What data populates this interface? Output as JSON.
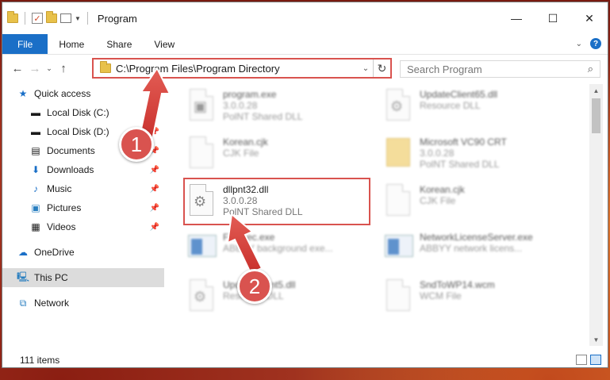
{
  "window": {
    "title": "Program"
  },
  "ribbon": {
    "tabs": [
      "File",
      "Home",
      "Share",
      "View"
    ]
  },
  "nav": {
    "address": "C:\\Program Files\\Program Directory",
    "search_placeholder": "Search Program"
  },
  "sidebar": {
    "quick_access": "Quick access",
    "items": [
      {
        "label": "Local Disk (C:)",
        "icon": "drive-icon"
      },
      {
        "label": "Local Disk (D:)",
        "icon": "drive-icon"
      },
      {
        "label": "Documents",
        "icon": "documents-icon"
      },
      {
        "label": "Downloads",
        "icon": "downloads-icon"
      },
      {
        "label": "Music",
        "icon": "music-icon"
      },
      {
        "label": "Pictures",
        "icon": "pictures-icon"
      },
      {
        "label": "Videos",
        "icon": "videos-icon"
      }
    ],
    "onedrive": "OneDrive",
    "thispc": "This PC",
    "network": "Network"
  },
  "files": [
    {
      "name": "program.exe",
      "line2": "3.0.0.28",
      "line3": "PolNT Shared DLL"
    },
    {
      "name": "UpdateClient65.dll",
      "line2": "Resource DLL",
      "line3": ""
    },
    {
      "name": "Korean.cjk",
      "line2": "CJK File",
      "line3": ""
    },
    {
      "name": "Microsoft VC90 CRT",
      "line2": "3.0.0.28",
      "line3": "PolNT Shared DLL"
    },
    {
      "name": "dllpnt32.dll",
      "line2": "3.0.0.28",
      "line3": "PolNT Shared DLL"
    },
    {
      "name": "Korean.cjk",
      "line2": "CJK File",
      "line3": ""
    },
    {
      "name": "FRExec.exe",
      "line2": "ABBYY background exe...",
      "line3": ""
    },
    {
      "name": "NetworkLicenseServer.exe",
      "line2": "ABBYY network licens...",
      "line3": ""
    },
    {
      "name": "UpdateClient5.dll",
      "line2": "Resource DLL",
      "line3": ""
    },
    {
      "name": "SndToWP14.wcm",
      "line2": "WCM File",
      "line3": ""
    }
  ],
  "status": {
    "count": "111 items"
  },
  "callouts": [
    "1",
    "2"
  ],
  "colors": {
    "accent": "#1a6fc7",
    "highlight": "#d9534f"
  }
}
